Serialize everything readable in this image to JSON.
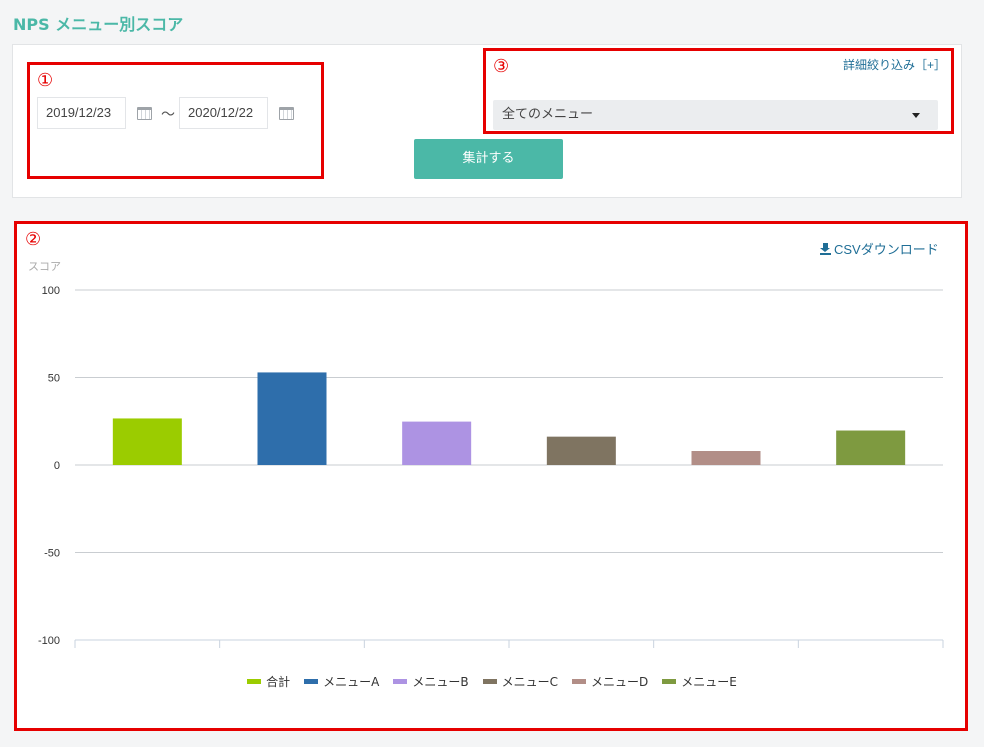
{
  "page": {
    "title": "NPS メニュー別スコア"
  },
  "filters": {
    "date_from": "2019/12/23",
    "date_separator": "〜",
    "date_to": "2020/12/22",
    "detail_link": "詳細絞り込み［+］",
    "menu_select_value": "全てのメニュー",
    "submit_label": "集計する"
  },
  "annotations": {
    "marker_1": "①",
    "marker_2": "②",
    "marker_3": "③"
  },
  "chart_panel": {
    "csv_label": "CSVダウンロード"
  },
  "icons": {
    "calendar": "calendar-icon",
    "download": "download-icon",
    "dropdown": "caret-down-icon"
  },
  "colors": {
    "title": "#4bb8a7",
    "button": "#4bb8a7",
    "link": "#1f6e96",
    "annotation": "#e60000"
  },
  "chart_data": {
    "type": "bar",
    "ylabel": "スコア",
    "ylim": [
      -100,
      100
    ],
    "yticks": [
      100,
      50,
      0,
      -50,
      -100
    ],
    "grid": true,
    "legend_position": "bottom",
    "categories": [
      "合計",
      "メニューA",
      "メニューB",
      "メニューC",
      "メニューD",
      "メニューE"
    ],
    "values": [
      26.6,
      52.9,
      24.8,
      16.2,
      8.0,
      19.7
    ],
    "colors": [
      "#9bcc00",
      "#2e6eab",
      "#ad93e3",
      "#7f7461",
      "#b28e87",
      "#7e9a40"
    ]
  }
}
